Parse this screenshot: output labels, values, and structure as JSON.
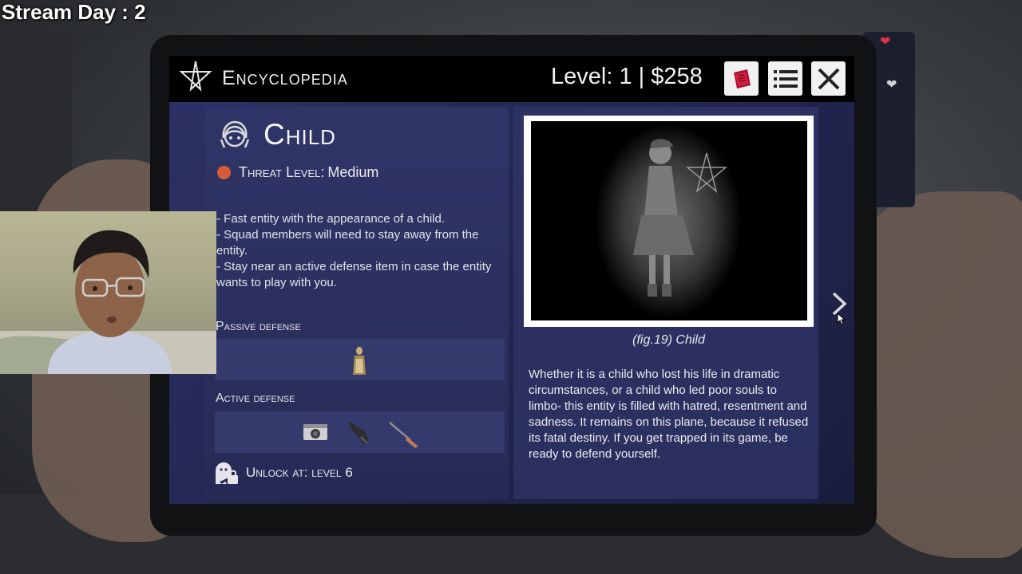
{
  "overlay": {
    "stream_label": "Stream Day : 2"
  },
  "header": {
    "title": "Encyclopedia",
    "level_money": "Level: 1 | $258",
    "icons": [
      "pentagram-icon",
      "book-icon",
      "list-icon",
      "close-icon"
    ]
  },
  "entity": {
    "name": "Child",
    "threat_label": "Threat Level:",
    "threat_value": "Medium",
    "threat_color": "#d85a36",
    "description": [
      "- Fast entity with the appearance of a child.",
      "- Squad members will need to stay away from the entity.",
      "- Stay near an active defense item in case the entity wants to play with you."
    ],
    "passive_label": "Passive defense",
    "active_label": "Active defense",
    "passive_items": [
      "idol-icon"
    ],
    "active_items": [
      "camera-icon",
      "gun-icon",
      "rifle-icon"
    ],
    "unlock_text": "Unlock at: level 6"
  },
  "figure": {
    "caption": "(fig.19) Child",
    "lore": "Whether it is a child who lost his life in dramatic circumstances, or a child who led poor souls to limbo- this entity is filled with hatred, resentment and sadness. It remains on this plane, because it refused its fatal destiny. If you get trapped in its game, be ready to defend yourself."
  },
  "colors": {
    "panel": "#2a2f5e",
    "topbar": "#000000",
    "accent_red": "#c8102e"
  }
}
